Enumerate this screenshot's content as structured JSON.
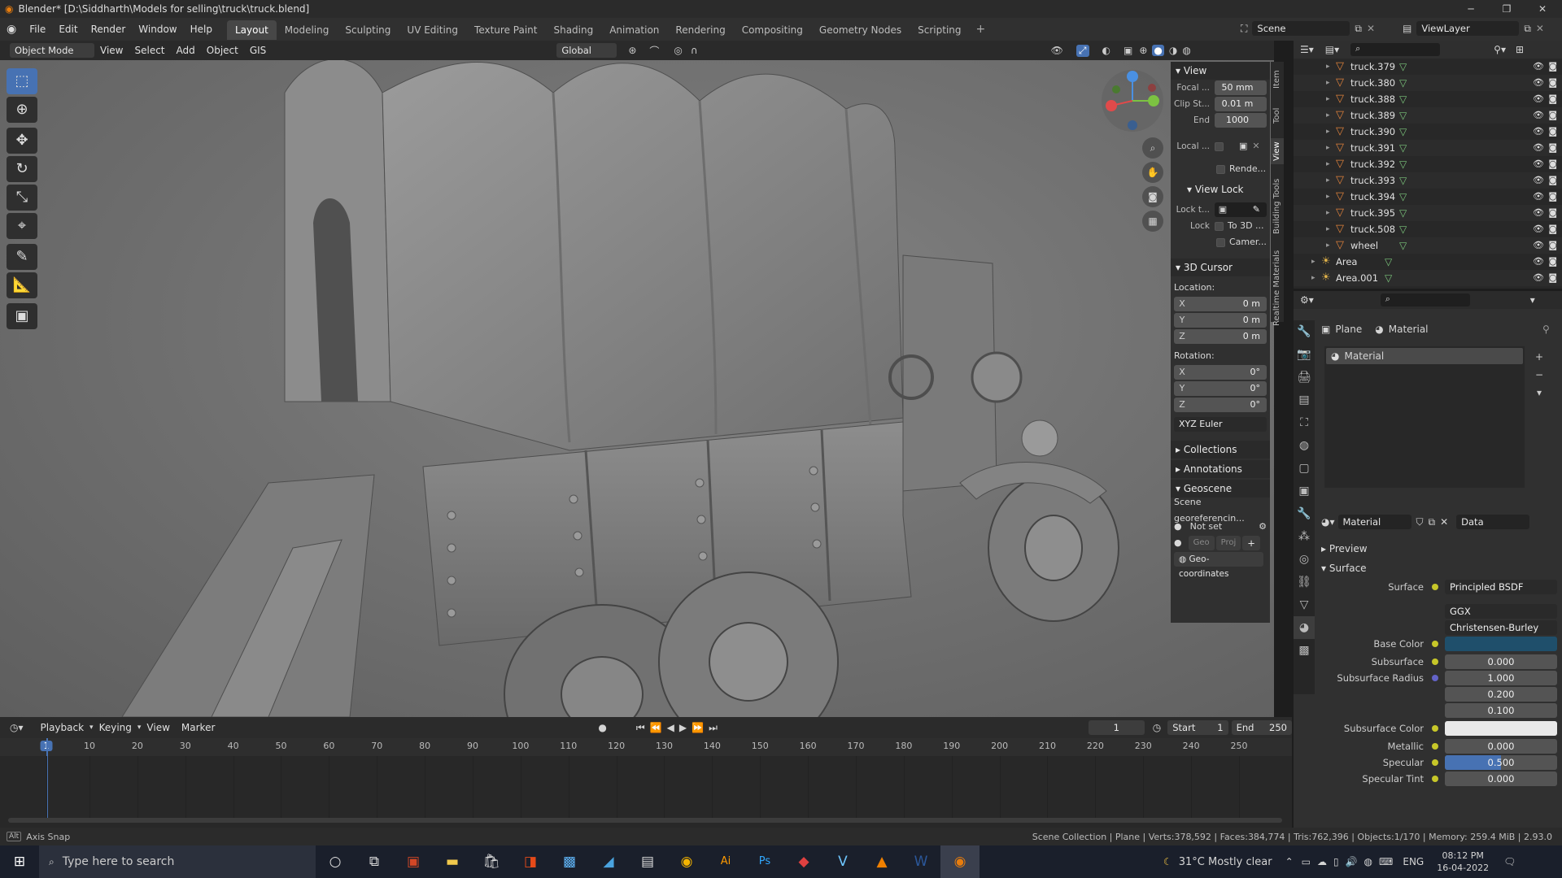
{
  "titlebar": {
    "title": "Blender* [D:\\Siddharth\\Models for selling\\truck\\truck.blend]",
    "min": "─",
    "max": "❐",
    "close": "✕"
  },
  "menu": {
    "file": "File",
    "edit": "Edit",
    "render": "Render",
    "window": "Window",
    "help": "Help"
  },
  "workspaces": [
    "Layout",
    "Modeling",
    "Sculpting",
    "UV Editing",
    "Texture Paint",
    "Shading",
    "Animation",
    "Rendering",
    "Compositing",
    "Geometry Nodes",
    "Scripting"
  ],
  "scene": {
    "label": "Scene",
    "viewlayer": "ViewLayer"
  },
  "header3d": {
    "mode": "Object Mode",
    "view": "View",
    "select": "Select",
    "add": "Add",
    "object": "Object",
    "gis": "GIS",
    "transform": "Global"
  },
  "npanel": {
    "tabs": [
      "Item",
      "Tool",
      "View",
      "Building Tools",
      "Realtime Materials"
    ],
    "view_title": "View",
    "focal_label": "Focal ...",
    "focal": "50 mm",
    "clip_label": "Clip St...",
    "clip": "0.01 m",
    "end_label": "End",
    "end": "1000",
    "local_label": "Local ...",
    "render_label": "Rende...",
    "viewlock_title": "View Lock",
    "lockto_label": "Lock t...",
    "lock_label": "Lock",
    "to3d": "To 3D ...",
    "camera": "Camer...",
    "cursor_title": "3D Cursor",
    "location": "Location:",
    "loc": [
      {
        "axis": "X",
        "val": "0 m"
      },
      {
        "axis": "Y",
        "val": "0 m"
      },
      {
        "axis": "Z",
        "val": "0 m"
      }
    ],
    "rotation": "Rotation:",
    "rot": [
      {
        "axis": "X",
        "val": "0°"
      },
      {
        "axis": "Y",
        "val": "0°"
      },
      {
        "axis": "Z",
        "val": "0°"
      }
    ],
    "euler": "XYZ Euler",
    "collections": "Collections",
    "annotations": "Annotations",
    "geoscene": "Geoscene",
    "georef": "Scene georeferencin...",
    "notset": "Not set",
    "geo": "Geo",
    "proj": "Proj",
    "geocoords": "Geo-coordinates"
  },
  "outliner": {
    "rows": [
      {
        "name": "truck.379",
        "type": "mesh"
      },
      {
        "name": "truck.380",
        "type": "mesh"
      },
      {
        "name": "truck.388",
        "type": "mesh"
      },
      {
        "name": "truck.389",
        "type": "mesh"
      },
      {
        "name": "truck.390",
        "type": "mesh"
      },
      {
        "name": "truck.391",
        "type": "mesh"
      },
      {
        "name": "truck.392",
        "type": "mesh"
      },
      {
        "name": "truck.393",
        "type": "mesh"
      },
      {
        "name": "truck.394",
        "type": "mesh"
      },
      {
        "name": "truck.395",
        "type": "mesh"
      },
      {
        "name": "truck.508",
        "type": "mesh"
      },
      {
        "name": "wheel",
        "type": "mesh"
      },
      {
        "name": "Area",
        "type": "light"
      },
      {
        "name": "Area.001",
        "type": "light"
      }
    ]
  },
  "props": {
    "breadcrumb_obj": "Plane",
    "breadcrumb_mat": "Material",
    "slot": "Material",
    "mat_name": "Material",
    "data": "Data",
    "preview": "Preview",
    "surface_sec": "Surface",
    "rows": [
      {
        "label": "Surface",
        "value": "Principled BSDF"
      },
      {
        "label": "",
        "value": "GGX"
      },
      {
        "label": "",
        "value": "Christensen-Burley"
      },
      {
        "label": "Base Color",
        "value": ""
      },
      {
        "label": "Subsurface",
        "value": "0.000"
      },
      {
        "label": "Subsurface Radius",
        "value": "1.000"
      },
      {
        "label": "",
        "value": "0.200"
      },
      {
        "label": "",
        "value": "0.100"
      },
      {
        "label": "Subsurface Color",
        "value": ""
      },
      {
        "label": "Metallic",
        "value": "0.000"
      },
      {
        "label": "Specular",
        "value": "0.500"
      },
      {
        "label": "Specular Tint",
        "value": "0.000"
      }
    ],
    "specular_fill": 0.5,
    "base_color": "#1f4f6b"
  },
  "timeline": {
    "playback": "Playback",
    "keying": "Keying",
    "view": "View",
    "marker": "Marker",
    "current": "1",
    "start_label": "Start",
    "start": "1",
    "end_label": "End",
    "end": "250",
    "frame_marks": [
      "1",
      "10",
      "20",
      "30",
      "40",
      "50",
      "60",
      "70",
      "80",
      "90",
      "100",
      "110",
      "120",
      "130",
      "140",
      "150",
      "160",
      "170",
      "180",
      "190",
      "200",
      "210",
      "220",
      "230",
      "240",
      "250"
    ]
  },
  "status": {
    "left": "Axis Snap",
    "right": "Scene Collection | Plane | Verts:378,592 | Faces:384,774 | Tris:762,396 | Objects:1/170 | Memory: 259.4 MiB | 2.93.0"
  },
  "taskbar": {
    "search": "Type here to search",
    "weather": "31°C  Mostly clear",
    "lang": "ENG",
    "time": "08:12 PM",
    "date": "16-04-2022"
  },
  "colors": {
    "accent": "#4772b3",
    "panel": "#303030"
  }
}
